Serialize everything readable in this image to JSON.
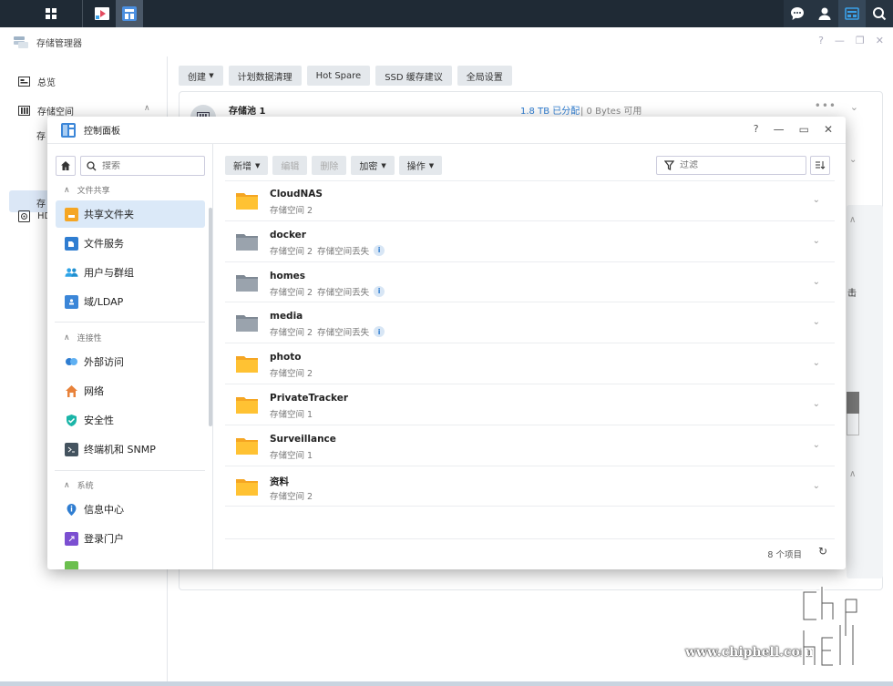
{
  "taskbar": {
    "left_icons": [
      "grid-icon",
      "media-app-icon",
      "control-panel-icon"
    ],
    "right_icons": [
      "chat-icon",
      "user-icon",
      "widgets-icon",
      "search-icon"
    ]
  },
  "storage_manager": {
    "title": "存储管理器",
    "nav": {
      "overview": "总览",
      "storage": "存储空间",
      "sub1": "存",
      "sub2": "存",
      "hdd": "HD"
    },
    "toolbar": [
      "创建",
      "计划数据清理",
      "Hot Spare",
      "SSD 缓存建议",
      "全局设置"
    ],
    "pool": {
      "name": "存储池 1",
      "allocated": "1.8 TB 已分配",
      "free": "| 0 Bytes 可用"
    },
    "side_text": "击"
  },
  "control_panel": {
    "title": "控制面板",
    "search_placeholder": "搜索",
    "groups": {
      "file_sharing": "文件共享",
      "connectivity": "连接性",
      "system": "系统"
    },
    "items": {
      "shared_folder": "共享文件夹",
      "file_services": "文件服务",
      "user_group": "用户与群组",
      "domain": "域/LDAP",
      "external_access": "外部访问",
      "network": "网络",
      "security": "安全性",
      "terminal": "终端机和 SNMP",
      "info_center": "信息中心",
      "login_portal": "登录门户"
    },
    "toolbar": {
      "create": "新增",
      "edit": "编辑",
      "delete": "删除",
      "encrypt": "加密",
      "action": "操作"
    },
    "filter_placeholder": "过滤",
    "folders": [
      {
        "name": "CloudNAS",
        "volume": "存储空间 2",
        "missing": "",
        "color": "#ffc233"
      },
      {
        "name": "docker",
        "volume": "存储空间 2",
        "missing": "存储空间丢失",
        "color": "#9aa3ad"
      },
      {
        "name": "homes",
        "volume": "存储空间 2",
        "missing": "存储空间丢失",
        "color": "#9aa3ad"
      },
      {
        "name": "media",
        "volume": "存储空间 2",
        "missing": "存储空间丢失",
        "color": "#9aa3ad"
      },
      {
        "name": "photo",
        "volume": "存储空间 2",
        "missing": "",
        "color": "#ffc233"
      },
      {
        "name": "PrivateTracker",
        "volume": "存储空间 1",
        "missing": "",
        "color": "#ffc233"
      },
      {
        "name": "Surveillance",
        "volume": "存储空间 1",
        "missing": "",
        "color": "#ffc233"
      },
      {
        "name": "资料",
        "volume": "存储空间 2",
        "missing": "",
        "color": "#ffc233"
      }
    ],
    "count": "8 个项目"
  },
  "watermark": {
    "url": "www.chiphell.com"
  },
  "colors": {
    "accent": "#2f7dd1",
    "folder_yellow": "#ffc233",
    "folder_gray": "#9aa3ad",
    "taskbar": "#1f2a35"
  }
}
